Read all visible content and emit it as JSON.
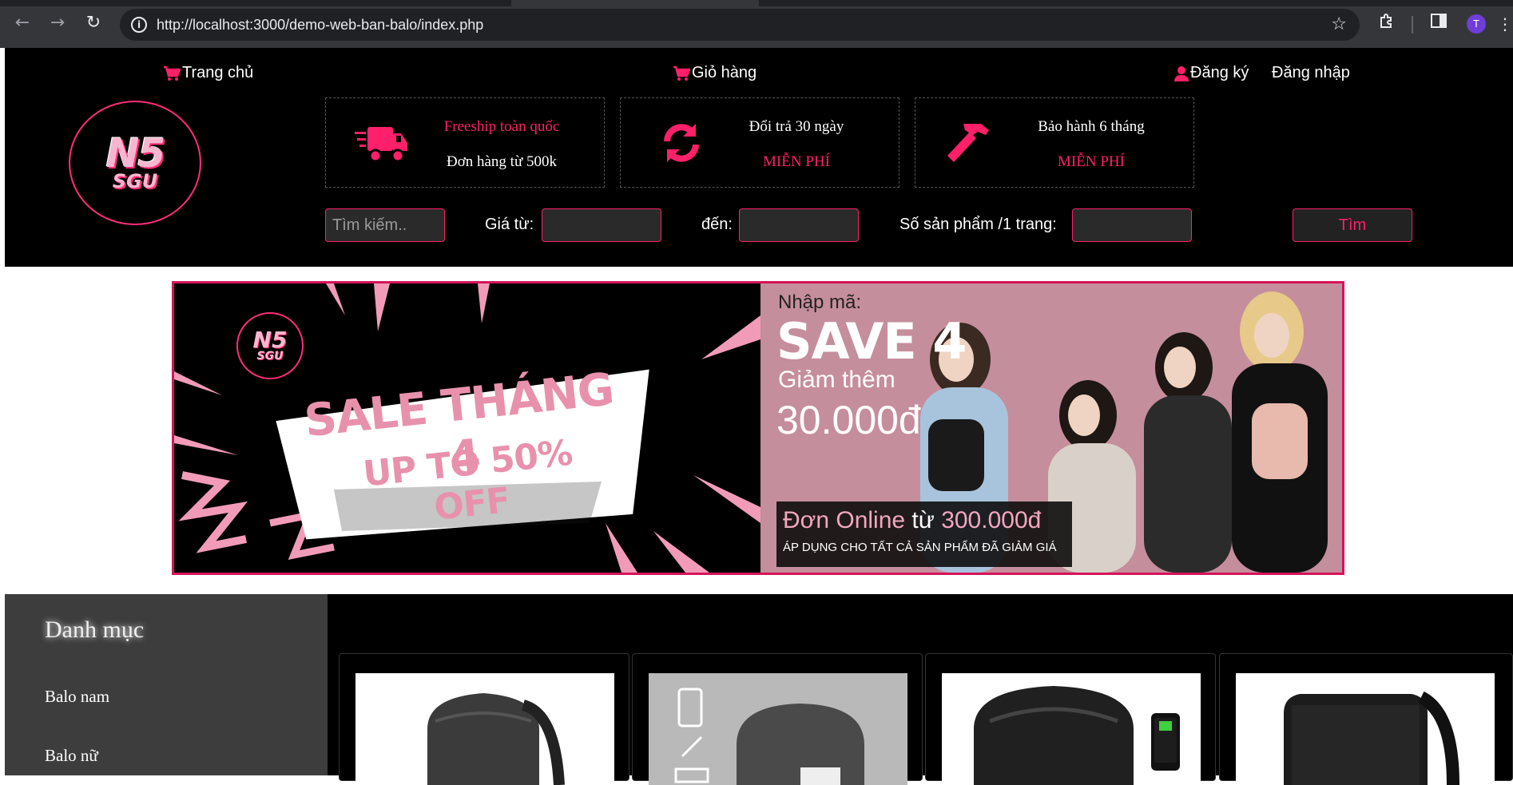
{
  "browser": {
    "url": "http://localhost:3000/demo-web-ban-balo/index.php",
    "profile_initial": "T"
  },
  "nav": {
    "home": "Trang chủ",
    "cart": "Giỏ hàng",
    "register": "Đăng ký",
    "login": "Đăng nhập"
  },
  "logo": {
    "line1": "N5",
    "line2": "SGU"
  },
  "features": [
    {
      "title": "Freeship toàn quốc",
      "subtitle": "Đơn hàng từ 500k",
      "icon": "truck-icon"
    },
    {
      "title": "Đổi trả 30 ngày",
      "subtitle": "MIỄN PHÍ",
      "icon": "sync-icon"
    },
    {
      "title": "Bảo hành 6 tháng",
      "subtitle": "MIỄN PHÍ",
      "icon": "hammer-icon"
    }
  ],
  "search": {
    "keyword_placeholder": "Tìm kiếm..",
    "price_from_label": "Giá từ:",
    "price_to_label": "đến:",
    "per_page_label": "Số sản phẩm /1 trang:",
    "submit_label": "Tìm"
  },
  "banner": {
    "logo_line1": "N5",
    "logo_line2": "SGU",
    "sale_line1": "SALE THÁNG 4",
    "sale_line2": "UP TO 50% OFF",
    "code_label": "Nhập mã:",
    "code": "SAVE 4",
    "discount_label": "Giảm thêm",
    "discount_amount": "30.000đ",
    "condition_prefix": "Đơn Online",
    "condition_from": "từ",
    "condition_amount": "300.000đ",
    "apply_note": "ÁP DỤNG CHO TẤT CẢ SẢN PHẨM ĐÃ GIẢM GIÁ"
  },
  "sidebar": {
    "title": "Danh mục",
    "items": [
      "Balo nam",
      "Balo nữ"
    ]
  },
  "colors": {
    "accent": "#ff1f6b",
    "header_bg": "#000000",
    "sidebar_bg": "#3d3d3d",
    "banner_pink": "#c58e9c"
  }
}
